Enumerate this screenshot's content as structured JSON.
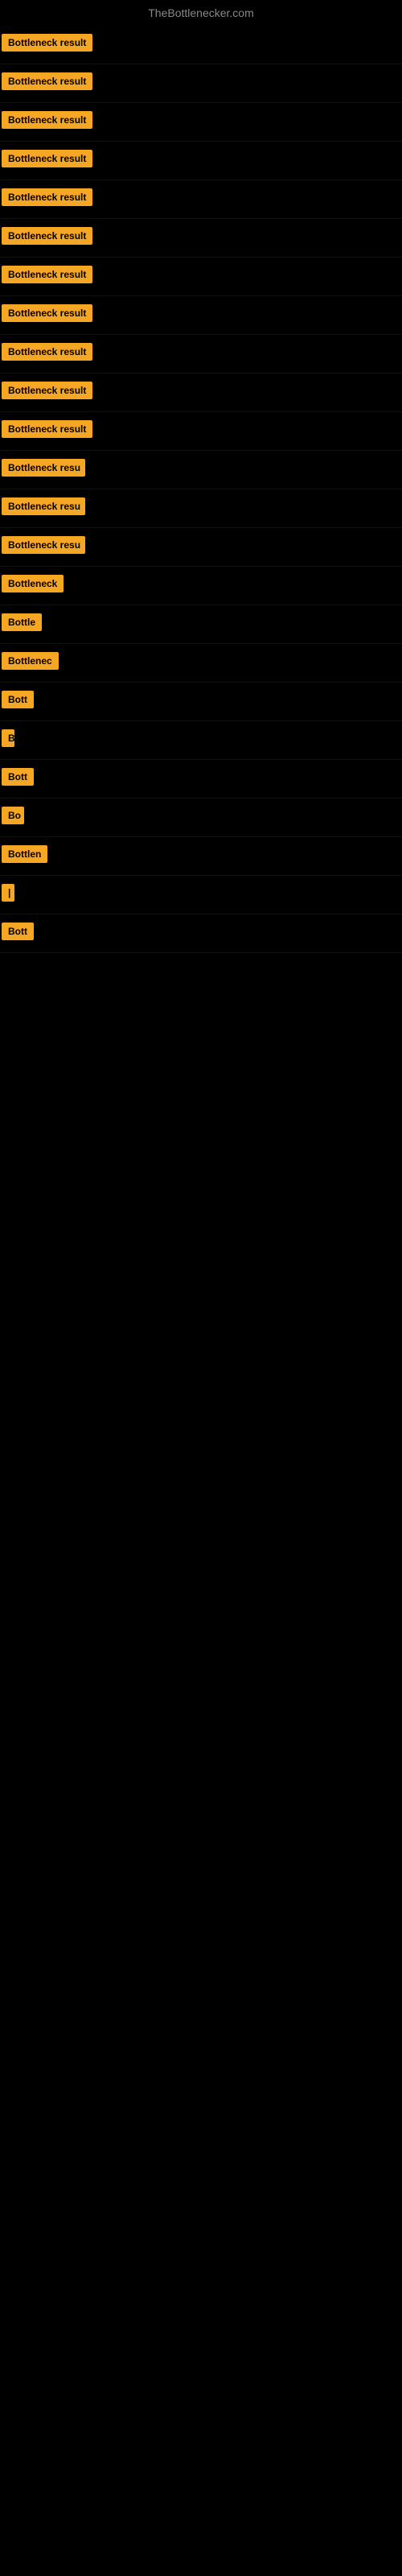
{
  "site": {
    "title": "TheBottlenecker.com"
  },
  "rows": [
    {
      "id": 1,
      "label": "Bottleneck result",
      "width": 120
    },
    {
      "id": 2,
      "label": "Bottleneck result",
      "width": 120
    },
    {
      "id": 3,
      "label": "Bottleneck result",
      "width": 120
    },
    {
      "id": 4,
      "label": "Bottleneck result",
      "width": 120
    },
    {
      "id": 5,
      "label": "Bottleneck result",
      "width": 120
    },
    {
      "id": 6,
      "label": "Bottleneck result",
      "width": 120
    },
    {
      "id": 7,
      "label": "Bottleneck result",
      "width": 120
    },
    {
      "id": 8,
      "label": "Bottleneck result",
      "width": 120
    },
    {
      "id": 9,
      "label": "Bottleneck result",
      "width": 120
    },
    {
      "id": 10,
      "label": "Bottleneck result",
      "width": 120
    },
    {
      "id": 11,
      "label": "Bottleneck result",
      "width": 120
    },
    {
      "id": 12,
      "label": "Bottleneck resu",
      "width": 104
    },
    {
      "id": 13,
      "label": "Bottleneck resu",
      "width": 104
    },
    {
      "id": 14,
      "label": "Bottleneck resu",
      "width": 104
    },
    {
      "id": 15,
      "label": "Bottleneck",
      "width": 80
    },
    {
      "id": 16,
      "label": "Bottle",
      "width": 52
    },
    {
      "id": 17,
      "label": "Bottlenec",
      "width": 72
    },
    {
      "id": 18,
      "label": "Bott",
      "width": 40
    },
    {
      "id": 19,
      "label": "B",
      "width": 16
    },
    {
      "id": 20,
      "label": "Bott",
      "width": 40
    },
    {
      "id": 21,
      "label": "Bo",
      "width": 28
    },
    {
      "id": 22,
      "label": "Bottlen",
      "width": 60
    },
    {
      "id": 23,
      "label": "|",
      "width": 10
    },
    {
      "id": 24,
      "label": "Bott",
      "width": 40
    }
  ]
}
